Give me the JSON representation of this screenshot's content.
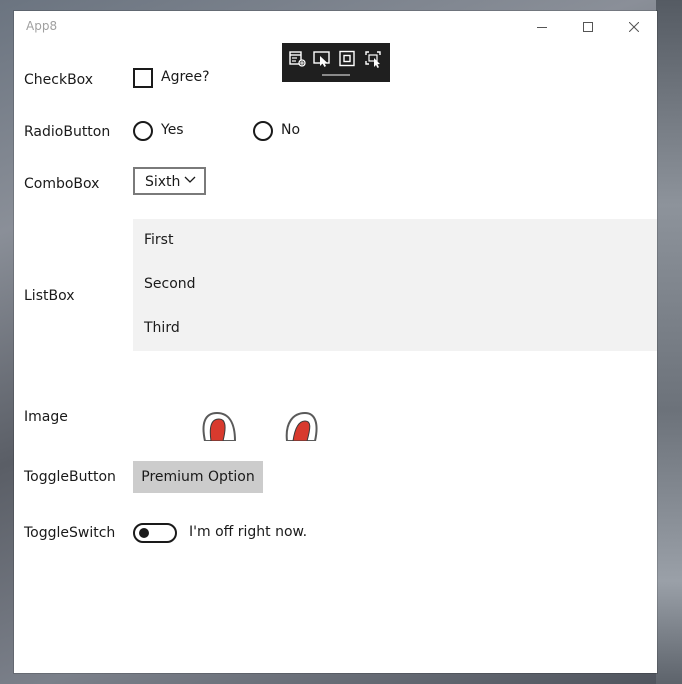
{
  "window": {
    "title": "App8",
    "caption": {
      "minimize": "minimize-icon",
      "maximize": "maximize-icon",
      "close": "close-icon"
    }
  },
  "dev_toolbar": {
    "tools": [
      "visual-tree-icon",
      "select-element-icon",
      "layout-adorners-icon",
      "track-focus-icon"
    ]
  },
  "labels": {
    "checkbox": "CheckBox",
    "radiobutton": "RadioButton",
    "combobox": "ComboBox",
    "listbox": "ListBox",
    "image": "Image",
    "togglebutton": "ToggleButton",
    "toggleswitch": "ToggleSwitch"
  },
  "checkbox": {
    "text": "Agree?",
    "checked": false
  },
  "radio": {
    "options": [
      {
        "text": "Yes",
        "selected": false
      },
      {
        "text": "No",
        "selected": false
      }
    ]
  },
  "combobox": {
    "selected": "Sixth"
  },
  "listbox": {
    "items": [
      "First",
      "Second",
      "Third"
    ]
  },
  "togglebutton": {
    "text": "Premium Option"
  },
  "toggleswitch": {
    "text": "I'm off right now.",
    "on": false
  },
  "colors": {
    "listbox_bg": "#f2f2f2",
    "togglebutton_bg": "#cccccc",
    "image_accent": "#d83a2e"
  }
}
